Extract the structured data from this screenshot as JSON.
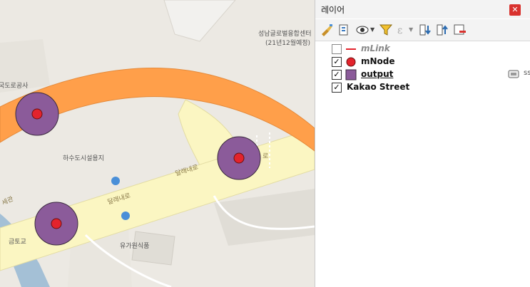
{
  "map": {
    "labels": {
      "place_1": "성남글로벌융합센터",
      "place_1_note": "(21년12월예정)",
      "place_2": "국도로공사",
      "place_3": "하수도시설용지",
      "place_4": "유가원식품",
      "place_5": "금토교",
      "road_1": "달래내로",
      "road_2": "달래내로",
      "road_3": "로",
      "road_4": "세관"
    },
    "colors": {
      "background": "#ece9e3",
      "road_yellow": "#fbf6c2",
      "highway_orange": "#ff9f4a",
      "node_fill": "#8b5b9a",
      "node_dot": "#e3232c",
      "river": "#a4c0d6"
    }
  },
  "panel": {
    "title": "레이어",
    "close_icon": "✕",
    "toolbar": [
      {
        "name": "style-manager-icon"
      },
      {
        "name": "add-group-icon"
      },
      {
        "name": "visibility-icon"
      },
      {
        "name": "filter-legend-icon"
      },
      {
        "name": "filter-expression-icon"
      },
      {
        "name": "expand-all-icon"
      },
      {
        "name": "collapse-all-icon"
      },
      {
        "name": "remove-layer-icon"
      }
    ],
    "layers": [
      {
        "name": "mLink",
        "checked": false,
        "symbol": "line",
        "color": "#e3232c"
      },
      {
        "name": "mNode",
        "checked": true,
        "symbol": "point",
        "color": "#e3232c"
      },
      {
        "name": "output",
        "checked": true,
        "symbol": "polygon",
        "color": "#8b5b9a"
      },
      {
        "name": "Kakao Street",
        "checked": true,
        "symbol": "none"
      }
    ],
    "check_mark": "✓",
    "side_cut_text": "ss"
  }
}
